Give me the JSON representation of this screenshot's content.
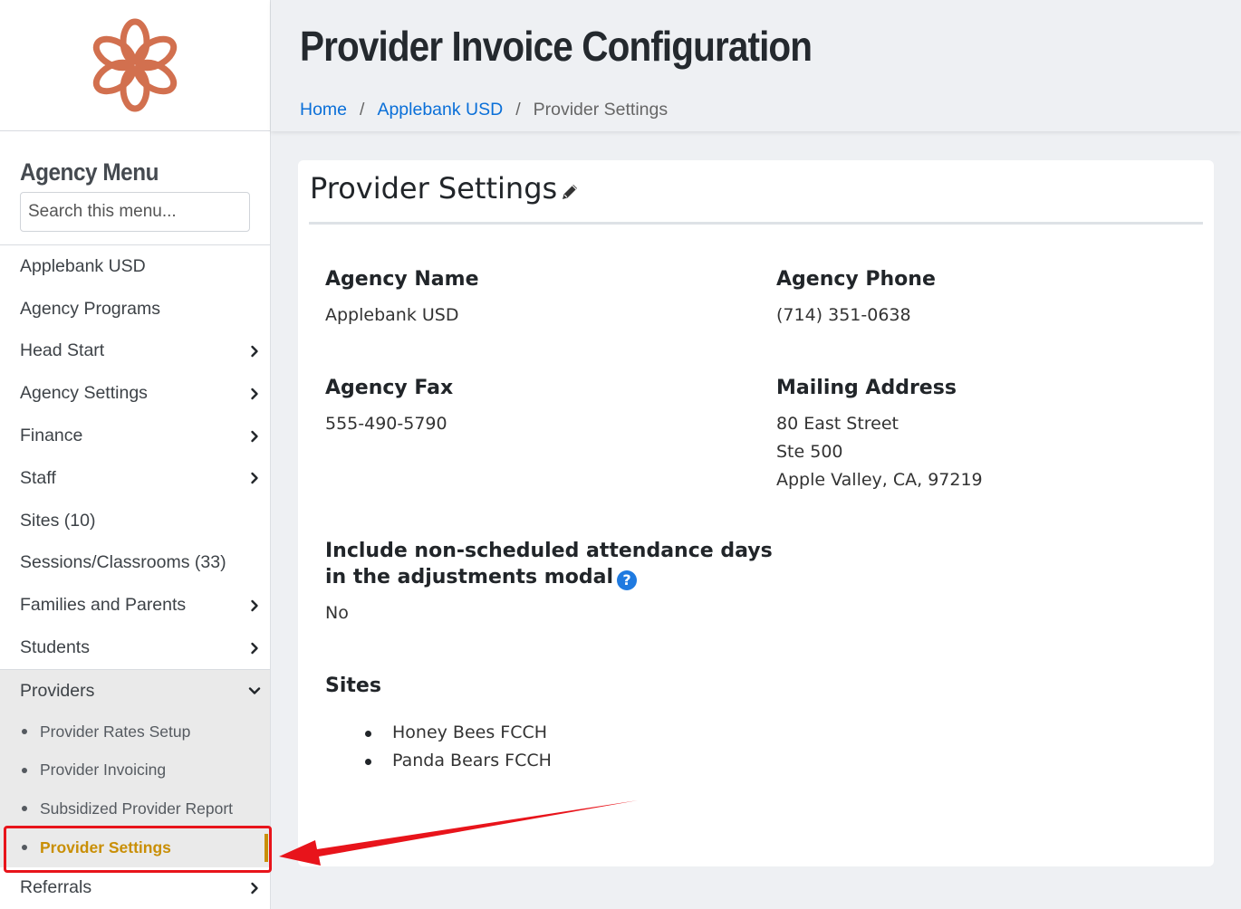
{
  "app": {
    "page_title": "Provider Invoice Configuration",
    "logo": "flower-logo",
    "brand_color": "#d2704f",
    "accent_color": "#0a6fd8",
    "active_color": "#c98f06",
    "annotation_color": "#e8141b"
  },
  "breadcrumb": {
    "items": [
      {
        "label": "Home",
        "link": true
      },
      {
        "label": "Applebank USD",
        "link": true
      },
      {
        "label": "Provider Settings",
        "link": false
      }
    ],
    "separator": "/"
  },
  "sidebar": {
    "menu_title": "Agency Menu",
    "search_placeholder": "Search this menu...",
    "items": [
      {
        "label": "Applebank USD",
        "has_children": false
      },
      {
        "label": "Agency Programs",
        "has_children": false
      },
      {
        "label": "Head Start",
        "has_children": true
      },
      {
        "label": "Agency Settings",
        "has_children": true
      },
      {
        "label": "Finance",
        "has_children": true
      },
      {
        "label": "Staff",
        "has_children": true
      },
      {
        "label": "Sites (10)",
        "has_children": false
      },
      {
        "label": "Sessions/Classrooms (33)",
        "has_children": false
      },
      {
        "label": "Families and Parents",
        "has_children": true
      },
      {
        "label": "Students",
        "has_children": true
      }
    ],
    "expanded_group": {
      "label": "Providers",
      "sub_items": [
        {
          "label": "Provider Rates Setup",
          "active": false
        },
        {
          "label": "Provider Invoicing",
          "active": false
        },
        {
          "label": "Subsidized Provider Report",
          "active": false
        },
        {
          "label": "Provider Settings",
          "active": true
        }
      ]
    },
    "after_items": [
      {
        "label": "Referrals",
        "has_children": true
      }
    ]
  },
  "card": {
    "title": "Provider Settings",
    "edit_icon": "pencil-icon",
    "agency_name_label": "Agency Name",
    "agency_name_value": "Applebank USD",
    "agency_phone_label": "Agency Phone",
    "agency_phone_value": "(714) 351-0638",
    "agency_fax_label": "Agency Fax",
    "agency_fax_value": "555-490-5790",
    "mailing_address_label": "Mailing Address",
    "mailing_address_lines": [
      "80 East Street",
      "Ste 500",
      "Apple Valley, CA, 97219"
    ],
    "nonscheduled_label_line1": "Include non-scheduled attendance days",
    "nonscheduled_label_line2": "in the adjustments modal",
    "nonscheduled_value": "No",
    "help_icon_glyph": "?",
    "sites_label": "Sites",
    "sites": [
      "Honey Bees FCCH",
      "Panda Bears FCCH"
    ]
  }
}
